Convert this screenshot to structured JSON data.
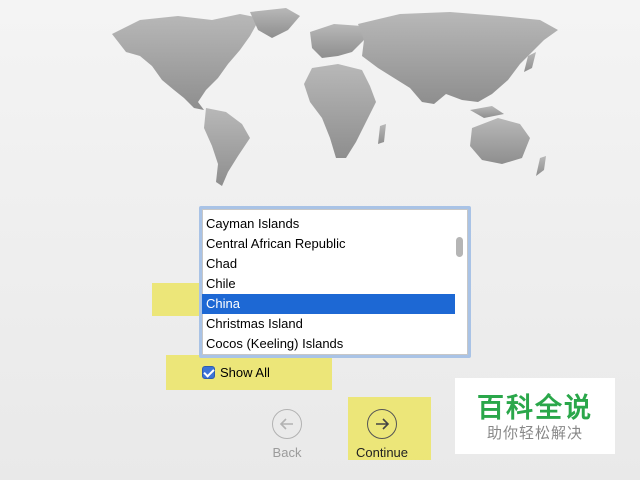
{
  "country_list": {
    "items": [
      {
        "label": "Cayman Islands",
        "selected": false
      },
      {
        "label": "Central African Republic",
        "selected": false
      },
      {
        "label": "Chad",
        "selected": false
      },
      {
        "label": "Chile",
        "selected": false
      },
      {
        "label": "China",
        "selected": true
      },
      {
        "label": "Christmas Island",
        "selected": false
      },
      {
        "label": "Cocos (Keeling) Islands",
        "selected": false
      }
    ]
  },
  "show_all": {
    "label": "Show All",
    "checked": true
  },
  "nav": {
    "back_label": "Back",
    "continue_label": "Continue"
  },
  "watermark": {
    "title": "百科全说",
    "subtitle": "助你轻松解决"
  },
  "colors": {
    "selection": "#1d68d4",
    "highlight": "#ece458",
    "watermark_green": "#2aa74a",
    "map": "#9a9a9a"
  },
  "icons": {
    "back": "arrow-left-circle-icon",
    "continue": "arrow-right-circle-icon",
    "map": "world-map-icon"
  }
}
